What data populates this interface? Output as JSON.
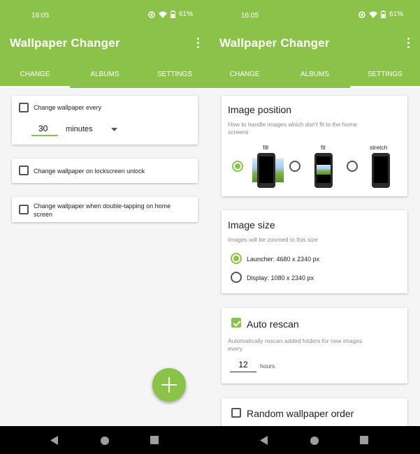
{
  "status": {
    "time": "16:05",
    "battery": "61%"
  },
  "app": {
    "title": "Wallpaper Changer"
  },
  "tabs": [
    {
      "label": "CHANGE"
    },
    {
      "label": "ALBUMS"
    },
    {
      "label": "SETTINGS"
    }
  ],
  "left": {
    "interval": {
      "label": "Change wallpaper every",
      "value": "30",
      "unit": "minutes",
      "checked": false
    },
    "lockscreen": {
      "label": "Change wallpaper on lockscreen unlock",
      "checked": false
    },
    "doubletap": {
      "label_line1": "Change wallpaper when double-tapping on home",
      "label_line2": "screen",
      "checked": false
    }
  },
  "right": {
    "image_position": {
      "title": "Image position",
      "desc_line1": "How to handle images which don't fit to the home",
      "desc_line2": "screens",
      "options": [
        {
          "label": "fill",
          "selected": true
        },
        {
          "label": "fit",
          "selected": false
        },
        {
          "label": "stretch",
          "selected": false
        }
      ]
    },
    "image_size": {
      "title": "Image size",
      "desc": "Images will be zoomed to this size",
      "options": [
        {
          "label": "Launcher: 4680 x 2340 px",
          "selected": true
        },
        {
          "label": "Display: 1080 x 2340 px",
          "selected": false
        }
      ]
    },
    "auto_rescan": {
      "title": "Auto rescan",
      "checked": true,
      "desc_line1": "Automatically rescan added folders for new images",
      "desc_line2": "every",
      "value": "12",
      "unit": "hours"
    },
    "random_order": {
      "title": "Random wallpaper order",
      "checked": false
    }
  },
  "colors": {
    "accent": "#8bc34a"
  }
}
